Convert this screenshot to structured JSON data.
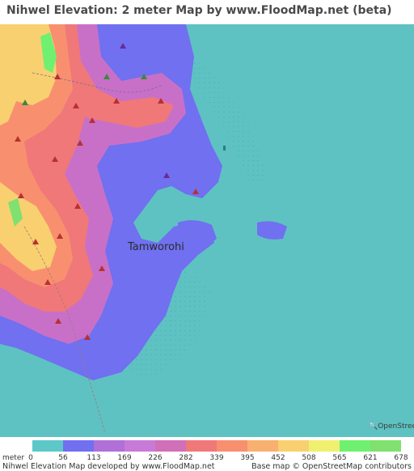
{
  "title": "Nihwel Elevation: 2 meter Map by www.FloodMap.net (beta)",
  "place_label": "Tamworohi",
  "osm_logo_text": "OpenStreetMap",
  "legend": {
    "unit": "meter",
    "ticks": [
      "0",
      "56",
      "113",
      "169",
      "226",
      "282",
      "339",
      "395",
      "452",
      "508",
      "565",
      "621",
      "678"
    ],
    "colors": [
      "#5ec8c8",
      "#7070f0",
      "#b070d8",
      "#c87ad8",
      "#d070b8",
      "#f07878",
      "#f89070",
      "#f8b070",
      "#f8d070",
      "#f0f070",
      "#70f070",
      "#80e070"
    ]
  },
  "footer": {
    "left": "Nihwel Elevation Map developed by www.FloodMap.net",
    "right": "Base map © OpenStreetMap contributors"
  },
  "colors": {
    "sea": "#5ec2c2",
    "low_land": "#7070f0",
    "mid_land": "#c870c8",
    "high_land": "#f07878",
    "peak_land": "#f8d070"
  }
}
